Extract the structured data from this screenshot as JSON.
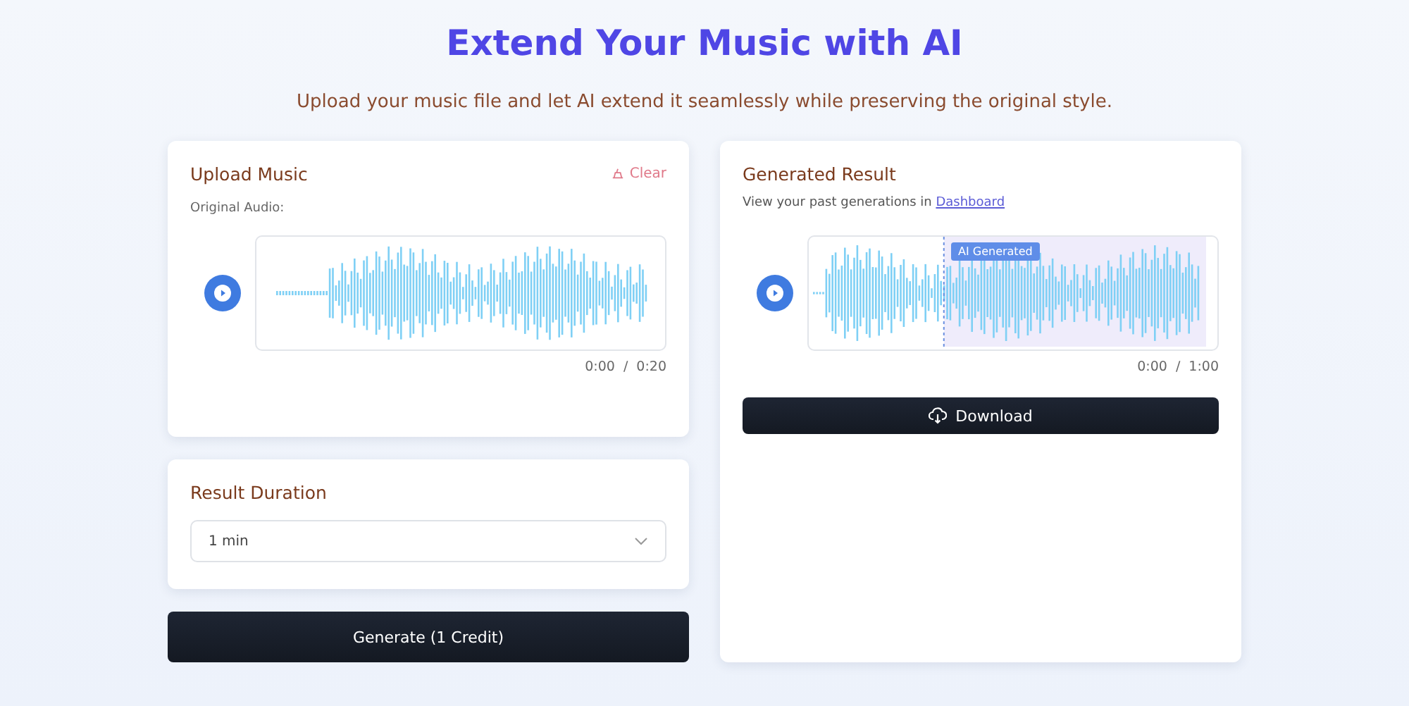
{
  "header": {
    "title": "Extend Your Music with AI",
    "subtitle": "Upload your music file and let AI extend it seamlessly while preserving the original style."
  },
  "upload": {
    "title": "Upload Music",
    "clear": "Clear",
    "label": "Original Audio:",
    "time": "0:00",
    "separator": "/",
    "duration": "0:20"
  },
  "duration": {
    "title": "Result Duration",
    "value": "1 min"
  },
  "generate": "Generate (1 Credit)",
  "result": {
    "title": "Generated Result",
    "note": "View your past generations in",
    "link": "Dashboard",
    "badge": "AI Generated",
    "time": "0:00",
    "separator": "/",
    "duration": "1:00",
    "download": "Download"
  }
}
